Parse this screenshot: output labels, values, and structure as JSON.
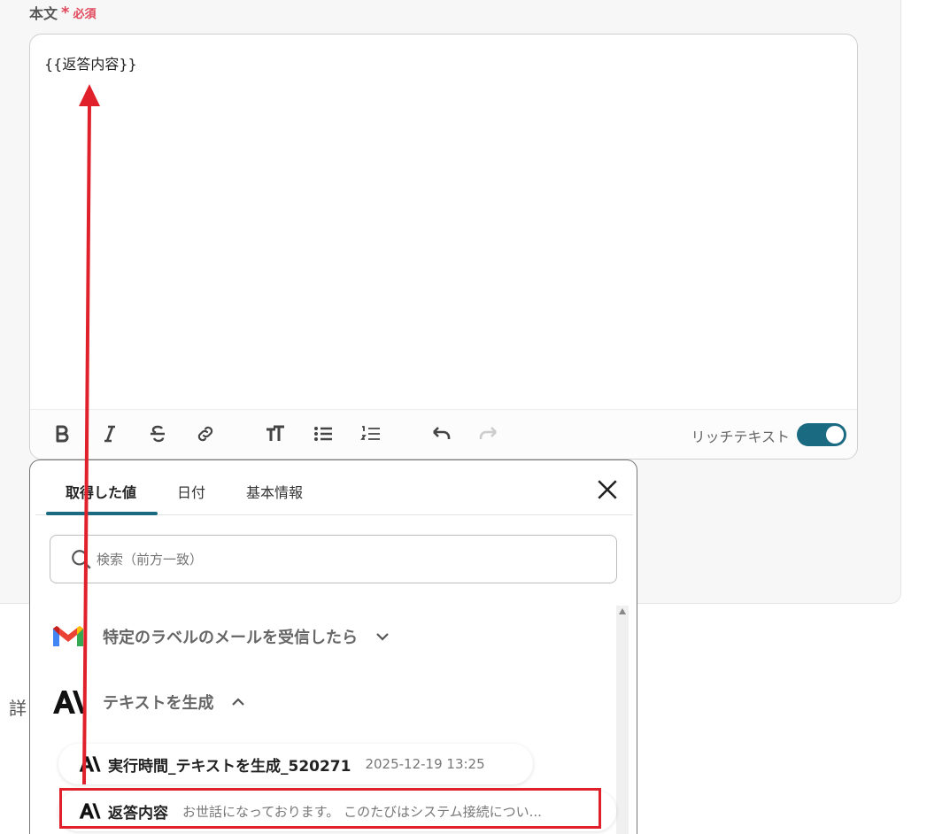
{
  "field": {
    "label": "本文",
    "required_mark": "*",
    "required_text": "必須"
  },
  "editor": {
    "content": "{{返答内容}}",
    "toolbar": {
      "items": [
        "bold",
        "italic",
        "strikethrough",
        "link",
        "font-size",
        "bullet-list",
        "numbered-list",
        "undo",
        "redo"
      ],
      "rich_text_label": "リッチテキスト",
      "rich_text_enabled": true
    }
  },
  "side": {
    "label": "詳"
  },
  "popup": {
    "tabs": [
      {
        "label": "取得した値",
        "active": true
      },
      {
        "label": "日付",
        "active": false
      },
      {
        "label": "基本情報",
        "active": false
      }
    ],
    "search": {
      "placeholder": "検索（前方一致）",
      "value": ""
    },
    "groups": [
      {
        "icon": "gmail-icon",
        "title": "特定のラベルのメールを受信したら",
        "expanded": false
      },
      {
        "icon": "anthropic-icon",
        "title": "テキストを生成",
        "expanded": true
      }
    ],
    "values": [
      {
        "icon": "anthropic-icon",
        "name": "実行時間_テキストを生成_520271",
        "preview": "2025-12-19 13:25"
      },
      {
        "icon": "anthropic-icon",
        "name": "返答内容",
        "preview": "お世話になっております。 このたびはシステム接続につい..."
      }
    ]
  },
  "colors": {
    "accent": "#1a6b82",
    "required": "#e0475b",
    "annotation": "#e0212b"
  }
}
